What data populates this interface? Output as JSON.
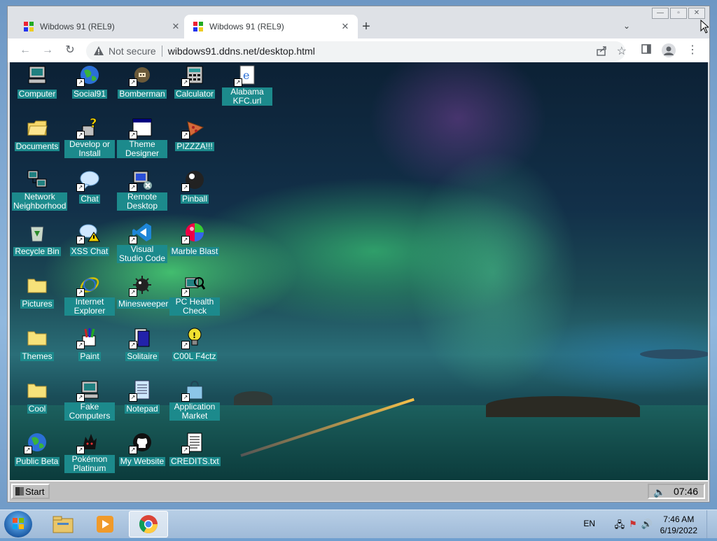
{
  "browser": {
    "tabs": [
      {
        "title": "Wibdows 91 (REL9)",
        "active": false
      },
      {
        "title": "Wibdows 91 (REL9)",
        "active": true
      }
    ],
    "security_label": "Not secure",
    "url": "wibdows91.ddns.net/desktop.html"
  },
  "desktop": {
    "icons": [
      {
        "label": "Computer",
        "icon": "computer-icon"
      },
      {
        "label": "Social91",
        "icon": "globe-icon"
      },
      {
        "label": "Bomberman",
        "icon": "bomberman-icon"
      },
      {
        "label": "Calculator",
        "icon": "calculator-icon"
      },
      {
        "label": "Alabama KFC.url",
        "icon": "internet-shortcut-icon"
      },
      {
        "label": "Documents",
        "icon": "folder-open-icon"
      },
      {
        "label": "Develop or Install",
        "icon": "setup-icon"
      },
      {
        "label": "Theme Designer",
        "icon": "window-icon"
      },
      {
        "label": "PIZZZA!!!",
        "icon": "pizza-icon"
      },
      {
        "label": "Network Neighborhood",
        "icon": "network-icon"
      },
      {
        "label": "Chat",
        "icon": "chat-bubble-icon"
      },
      {
        "label": "Remote Desktop",
        "icon": "remote-desktop-icon"
      },
      {
        "label": "Pinball",
        "icon": "pinball-icon"
      },
      {
        "label": "Recycle Bin",
        "icon": "recycle-bin-icon"
      },
      {
        "label": "XSS Chat",
        "icon": "warning-chat-icon"
      },
      {
        "label": "Visual Studio Code",
        "icon": "vscode-icon"
      },
      {
        "label": "Marble Blast",
        "icon": "marble-icon"
      },
      {
        "label": "Pictures",
        "icon": "folder-icon"
      },
      {
        "label": "Internet Explorer",
        "icon": "internet-explorer-icon"
      },
      {
        "label": "Minesweeper",
        "icon": "mine-icon"
      },
      {
        "label": "PC Health Check",
        "icon": "health-check-icon"
      },
      {
        "label": "Themes",
        "icon": "folder-icon"
      },
      {
        "label": "Paint",
        "icon": "paint-icon"
      },
      {
        "label": "Solitaire",
        "icon": "cards-icon"
      },
      {
        "label": "C00L F4ctz",
        "icon": "lightbulb-icon"
      },
      {
        "label": "Cool",
        "icon": "folder-icon"
      },
      {
        "label": "Fake Computers",
        "icon": "computer-icon"
      },
      {
        "label": "Notepad",
        "icon": "notepad-icon"
      },
      {
        "label": "Application Market",
        "icon": "shopping-bag-icon"
      },
      {
        "label": "Public Beta",
        "icon": "globe-icon"
      },
      {
        "label": "Pokémon Platinum",
        "icon": "pokemon-icon"
      },
      {
        "label": "My Website",
        "icon": "github-icon"
      },
      {
        "label": "CREDITS.txt",
        "icon": "text-file-icon"
      }
    ],
    "taskbar": {
      "start_label": "Start",
      "clock": "07:46"
    }
  },
  "host_taskbar": {
    "language": "EN",
    "time": "7:46 AM",
    "date": "6/19/2022"
  },
  "colors": {
    "icon_label_bg": "#1c8a8c",
    "chrome_frame": "#dee1e6"
  }
}
